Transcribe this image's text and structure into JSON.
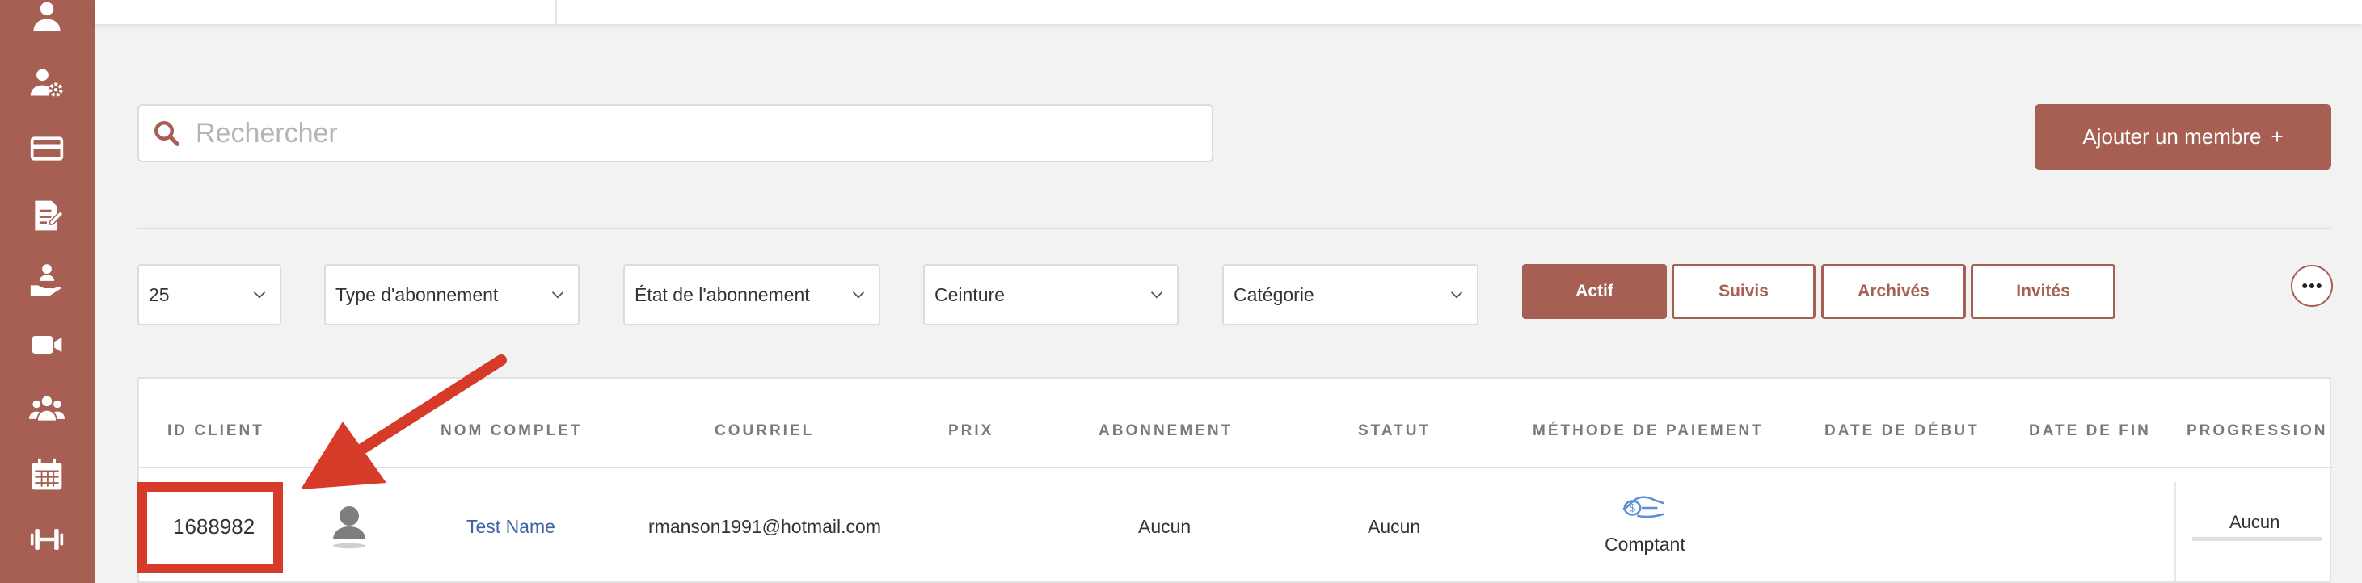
{
  "search": {
    "placeholder": "Rechercher"
  },
  "add_member": {
    "label": "Ajouter un membre",
    "plus": "+"
  },
  "filters": {
    "page_size": "25",
    "subscription_type": "Type d'abonnement",
    "subscription_state": "État de l'abonnement",
    "belt": "Ceinture",
    "category": "Catégorie"
  },
  "tabs": [
    {
      "label": "Actif",
      "active": true
    },
    {
      "label": "Suivis",
      "active": false
    },
    {
      "label": "Archivés",
      "active": false
    },
    {
      "label": "Invités",
      "active": false
    }
  ],
  "more_icon": "more-horizontal-icon",
  "table": {
    "headers": [
      "ID CLIENT",
      "NOM COMPLET",
      "COURRIEL",
      "PRIX",
      "ABONNEMENT",
      "STATUT",
      "MÉTHODE DE PAIEMENT",
      "DATE DE DÉBUT",
      "DATE DE FIN",
      "PROGRESSION"
    ],
    "rows": [
      {
        "id": "1688982",
        "name": "Test Name",
        "email": "rmanson1991@hotmail.com",
        "price": "",
        "subscription": "Aucun",
        "status": "Aucun",
        "payment_method": "Comptant",
        "start_date": "",
        "end_date": "",
        "progression": "Aucun"
      }
    ]
  },
  "sidebar_icons": [
    "user-icon",
    "user-settings-icon",
    "credit-card-icon",
    "document-edit-icon",
    "hand-holding-user-icon",
    "video-camera-icon",
    "users-group-icon",
    "calendar-icon",
    "dumbbell-icon"
  ],
  "colors": {
    "brand": "#a65f52",
    "annotation": "#d63b2a",
    "link": "#3f62a6"
  }
}
